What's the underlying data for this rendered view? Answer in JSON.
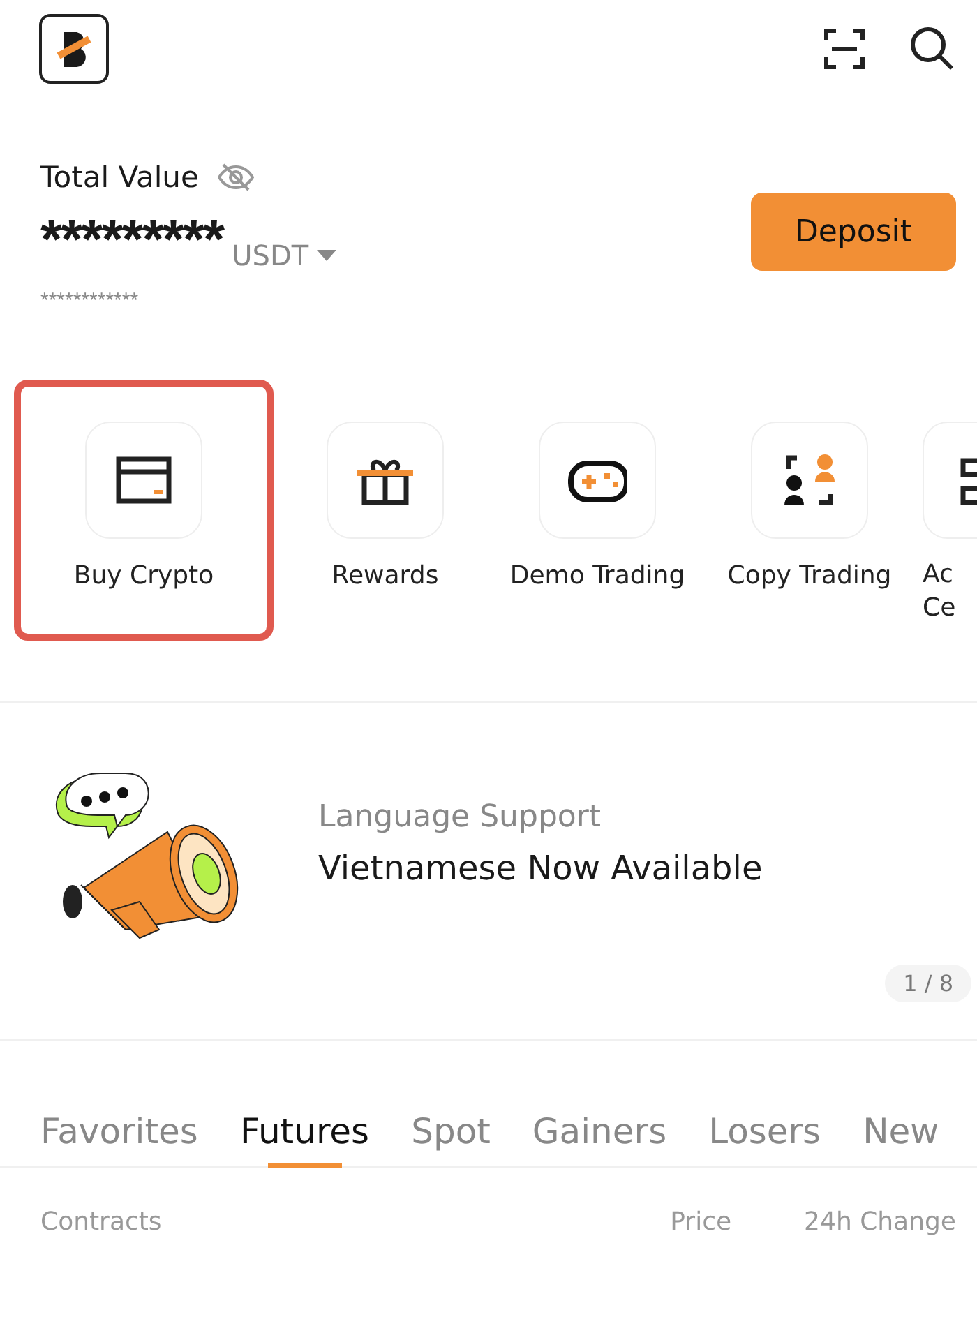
{
  "header": {
    "balance_label": "Total Value",
    "balance": "*********",
    "currency": "USDT",
    "sub_balance": "************",
    "deposit_button": "Deposit"
  },
  "shortcuts": [
    {
      "label": "Buy Crypto",
      "highlighted": true
    },
    {
      "label": "Rewards",
      "highlighted": false
    },
    {
      "label": "Demo Trading",
      "highlighted": false
    },
    {
      "label": "Copy Trading",
      "highlighted": false
    },
    {
      "label": "Ac Ce",
      "highlighted": false
    }
  ],
  "banner": {
    "subtitle": "Language Support",
    "title": "Vietnamese Now Available",
    "pager": "1 / 8"
  },
  "tabs": [
    {
      "label": "Favorites",
      "selected": false
    },
    {
      "label": "Futures",
      "selected": true
    },
    {
      "label": "Spot",
      "selected": false
    },
    {
      "label": "Gainers",
      "selected": false
    },
    {
      "label": "Losers",
      "selected": false
    },
    {
      "label": "New",
      "selected": false
    }
  ],
  "columns": [
    "Contracts",
    "Price",
    "24h Change"
  ]
}
